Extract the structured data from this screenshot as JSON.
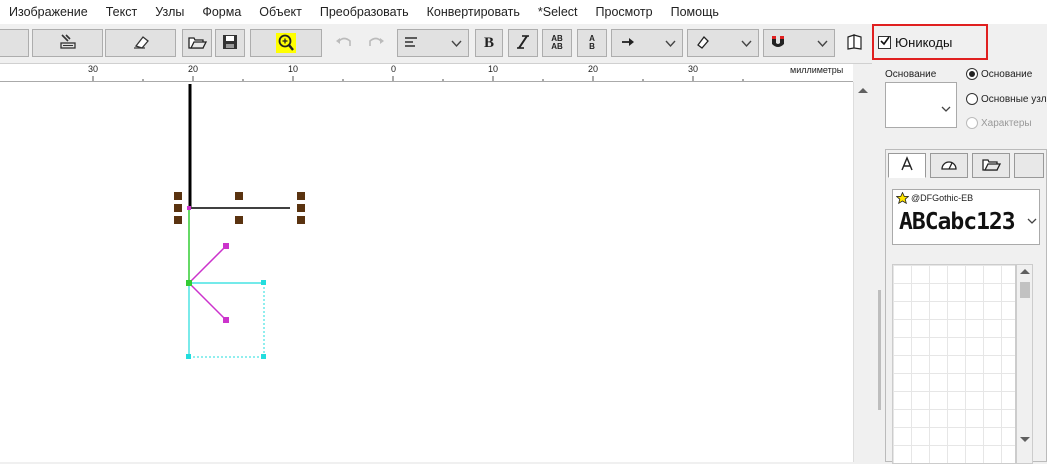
{
  "menu": [
    "Изображение",
    "Текст",
    "Узлы",
    "Форма",
    "Объект",
    "Преобразовать",
    "Конвертировать",
    "*Select",
    "Просмотр",
    "Помощь"
  ],
  "toolbar": {
    "unicode_label": "Юникоды",
    "unicode_checked": true,
    "bold_label": "B",
    "kern_top": "AB",
    "kern_bottom": "AB",
    "case_top": "A",
    "case_bottom": "B"
  },
  "ruler": {
    "unit": "миллиметры",
    "ticks": [
      "30",
      "20",
      "10",
      "0",
      "10",
      "20",
      "30"
    ]
  },
  "right_panel": {
    "base_label": "Основание",
    "radio_options": [
      {
        "label": "Основание",
        "selected": true,
        "enabled": true
      },
      {
        "label": "Основные узлы",
        "selected": false,
        "enabled": true
      },
      {
        "label": "Характеры",
        "selected": false,
        "enabled": false
      }
    ],
    "tab_icons": [
      "letter-a-icon",
      "gauge-icon",
      "open-folder-icon"
    ],
    "font_name": "@DFGothic-EB",
    "font_sample": "ABCabc123"
  },
  "colors": {
    "highlight_red": "#e02020",
    "node_brown": "#5a3310",
    "guide_magenta": "#cc33cc",
    "guide_cyan": "#22dddd",
    "zoom_yellow": "#ffff00"
  }
}
